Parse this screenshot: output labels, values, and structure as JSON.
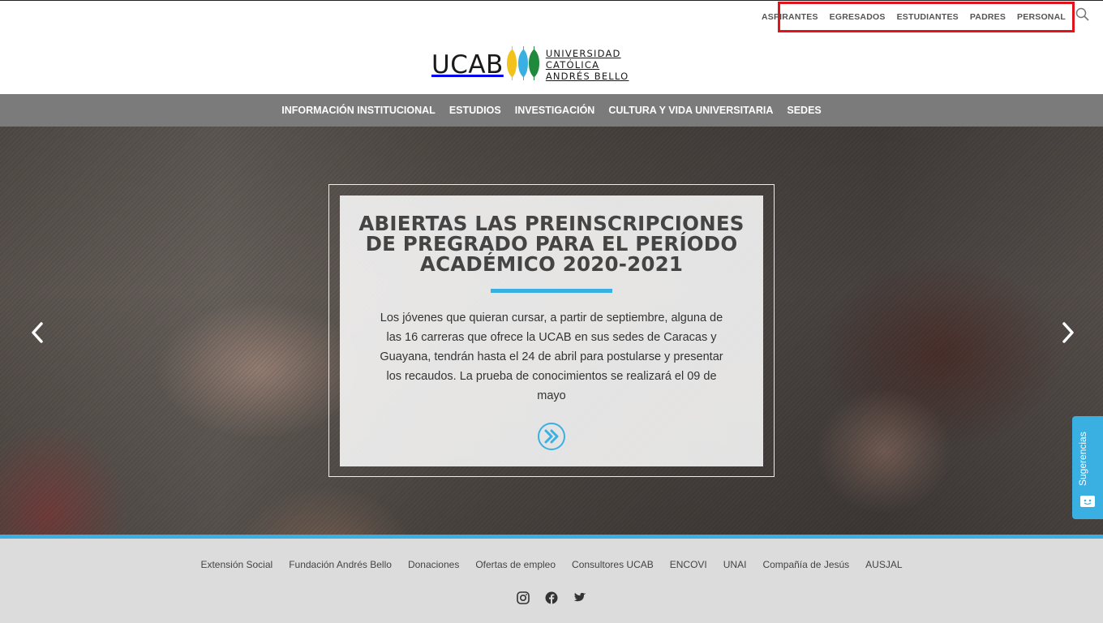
{
  "audience_nav": {
    "items": [
      {
        "label": "ASPIRANTES"
      },
      {
        "label": "EGRESADOS"
      },
      {
        "label": "ESTUDIANTES"
      },
      {
        "label": "PADRES"
      },
      {
        "label": "PERSONAL"
      }
    ],
    "search_icon": "search-icon"
  },
  "logo": {
    "wordmark": "UCAB",
    "line1": "UNIVERSIDAD CATÓLICA",
    "line2": "ANDRÉS BELLO"
  },
  "main_nav": {
    "items": [
      {
        "label": "INFORMACIÓN INSTITUCIONAL"
      },
      {
        "label": "ESTUDIOS"
      },
      {
        "label": "INVESTIGACIÓN"
      },
      {
        "label": "CULTURA Y VIDA UNIVERSITARIA"
      },
      {
        "label": "SEDES"
      }
    ]
  },
  "hero": {
    "title": "ABIERTAS LAS PREINSCRIPCIONES DE PREGRADO PARA EL PERÍODO ACADÉMICO 2020-2021",
    "text": "Los jóvenes que quieran cursar, a partir de septiembre, alguna de las 16 carreras que ofrece la UCAB en sus sedes de Caracas y Guayana, tendrán hasta el 24 de abril para postularse y presentar los recaudos. La prueba de conocimientos se realizará el 09 de mayo",
    "more_icon": "double-chevron-right-icon",
    "prev_icon": "chevron-left-icon",
    "next_icon": "chevron-right-icon"
  },
  "feedback": {
    "label": "Sugerencias",
    "icon": "chat-icon"
  },
  "footer": {
    "links": [
      {
        "label": "Extensión Social"
      },
      {
        "label": "Fundación Andrés Bello"
      },
      {
        "label": "Donaciones"
      },
      {
        "label": "Ofertas de empleo"
      },
      {
        "label": "Consultores UCAB"
      },
      {
        "label": "ENCOVI"
      },
      {
        "label": "UNAI"
      },
      {
        "label": "Compañía de Jesús"
      },
      {
        "label": "AUSJAL"
      }
    ],
    "social": [
      "instagram-icon",
      "facebook-icon",
      "twitter-icon"
    ]
  },
  "colors": {
    "accent": "#3ab0e2",
    "nav_bg": "#7b7b7b",
    "footer_bg": "#dcdcdc",
    "highlight_border": "#e0141a",
    "logo_yellow": "#f2c11b",
    "logo_blue": "#3ab0e2",
    "logo_green": "#1f8a3c"
  }
}
